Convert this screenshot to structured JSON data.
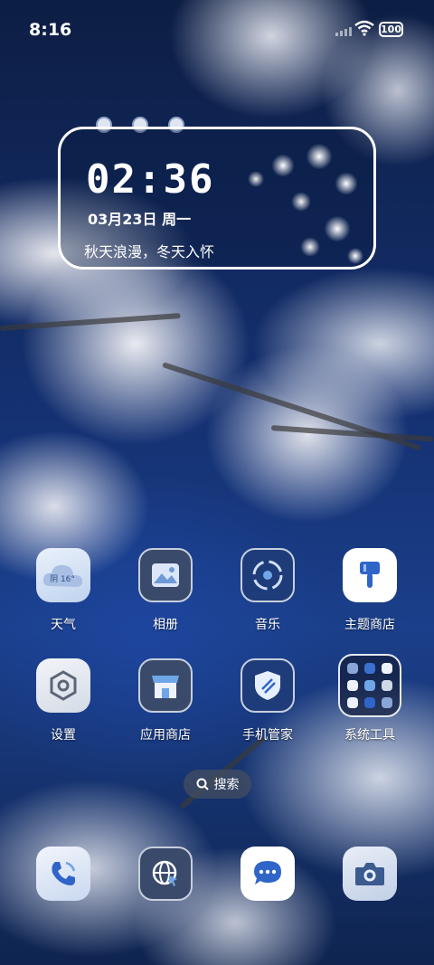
{
  "status_bar": {
    "time": "8:16",
    "battery": "100"
  },
  "widget": {
    "clock": "02:36",
    "date": "03月23日 周一",
    "quote": "秋天浪漫，冬天入怀"
  },
  "weather_icon_text": "阴 16°",
  "apps": [
    {
      "label": "天气",
      "icon": "cloud-weather-icon"
    },
    {
      "label": "相册",
      "icon": "photo-icon"
    },
    {
      "label": "音乐",
      "icon": "music-disc-icon"
    },
    {
      "label": "主题商店",
      "icon": "paint-brush-icon"
    },
    {
      "label": "设置",
      "icon": "gear-icon"
    },
    {
      "label": "应用商店",
      "icon": "store-icon"
    },
    {
      "label": "手机管家",
      "icon": "shield-icon"
    },
    {
      "label": "系统工具",
      "icon": "folder-icon"
    }
  ],
  "search": {
    "label": "搜索"
  },
  "dock": [
    {
      "icon": "phone-icon"
    },
    {
      "icon": "browser-globe-icon"
    },
    {
      "icon": "message-icon"
    },
    {
      "icon": "camera-icon"
    }
  ],
  "colors": {
    "accent_blue": "#2f64c8",
    "dark_tile": "#3a4a6a",
    "navy_tile": "#1e3b7a"
  }
}
